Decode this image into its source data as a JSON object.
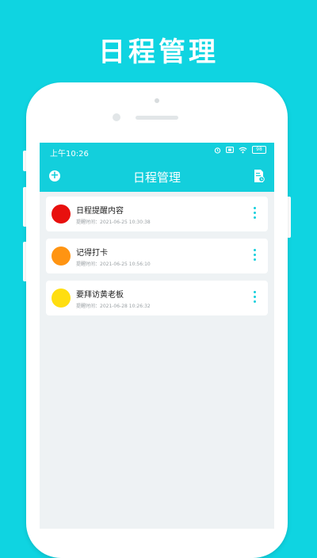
{
  "promo": {
    "title": "日程管理"
  },
  "status_bar": {
    "time": "上午10:26",
    "battery": "98"
  },
  "header": {
    "title": "日程管理"
  },
  "colors": {
    "accent": "#13cfdc",
    "background": "#0fd4e1"
  },
  "schedules": [
    {
      "title": "日程提醒内容",
      "time": "提醒时间：2021-06-25 10:30:38",
      "color": "#e8100e"
    },
    {
      "title": "记得打卡",
      "time": "提醒时间：2021-06-25 10:56:10",
      "color": "#ff9412"
    },
    {
      "title": "要拜访黄老板",
      "time": "提醒时间：2021-06-28 10:26:32",
      "color": "#ffde10"
    }
  ]
}
